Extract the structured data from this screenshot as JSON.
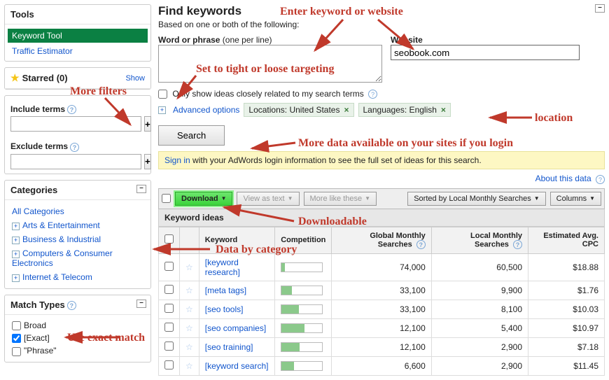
{
  "sidebar": {
    "tools_header": "Tools",
    "tool_selected": "Keyword Tool",
    "tool_link": "Traffic Estimator",
    "starred_label": "Starred (0)",
    "show": "Show",
    "include_label": "Include terms",
    "exclude_label": "Exclude terms",
    "categories_header": "Categories",
    "categories": [
      "All Categories",
      "Arts & Entertainment",
      "Business & Industrial",
      "Computers & Consumer Electronics",
      "Internet & Telecom"
    ],
    "match_header": "Match Types",
    "match_broad": "Broad",
    "match_exact": "[Exact]",
    "match_phrase": "\"Phrase\""
  },
  "main": {
    "title": "Find keywords",
    "subtitle": "Based on one or both of the following:",
    "word_label": "Word or phrase",
    "word_sub": " (one per line)",
    "website_label": "Website",
    "website_value": "seobook.com",
    "only_show": "Only show ideas closely related to my search terms",
    "advanced": "Advanced options",
    "tag_location": "Locations: United States",
    "tag_language": "Languages: English",
    "search_btn": "Search",
    "signin_link": "Sign in",
    "signin_text": " with your AdWords login information to see the full set of ideas for this search.",
    "about": "About this data"
  },
  "toolbar": {
    "download": "Download",
    "view_text": "View as text",
    "more_like": "More like these",
    "sorted": "Sorted by Local Monthly Searches",
    "columns": "Columns"
  },
  "table": {
    "ideas_header": "Keyword ideas",
    "col_keyword": "Keyword",
    "col_comp": "Competition",
    "col_global": "Global Monthly Searches",
    "col_local": "Local Monthly Searches",
    "col_cpc": "Estimated Avg. CPC",
    "rows": [
      {
        "kw": "[keyword research]",
        "comp": 8,
        "global": "74,000",
        "local": "60,500",
        "cpc": "$18.88"
      },
      {
        "kw": "[meta tags]",
        "comp": 26,
        "global": "33,100",
        "local": "9,900",
        "cpc": "$1.76"
      },
      {
        "kw": "[seo tools]",
        "comp": 42,
        "global": "33,100",
        "local": "8,100",
        "cpc": "$10.03"
      },
      {
        "kw": "[seo companies]",
        "comp": 56,
        "global": "12,100",
        "local": "5,400",
        "cpc": "$10.97"
      },
      {
        "kw": "[seo training]",
        "comp": 44,
        "global": "12,100",
        "local": "2,900",
        "cpc": "$7.18"
      },
      {
        "kw": "[keyword search]",
        "comp": 30,
        "global": "6,600",
        "local": "2,900",
        "cpc": "$11.45"
      }
    ]
  },
  "annotations": {
    "enter_kw": "Enter keyword or website",
    "targeting": "Set to tight or loose targeting",
    "location": "location",
    "login": "More data available on your sites if you login",
    "more_filters": "More filters",
    "downloadable": "Downloadable",
    "by_cat": "Data by category",
    "exact": "Use exact match"
  }
}
